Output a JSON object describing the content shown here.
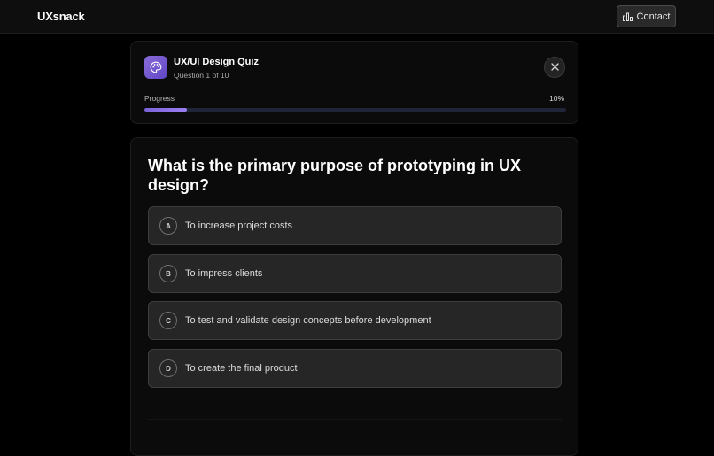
{
  "nav": {
    "logo": "UXsnack",
    "contact_label": "Contact"
  },
  "quiz": {
    "title": "UX/UI Design Quiz",
    "question_counter": "Question 1 of 10",
    "progress_label": "Progress",
    "progress_text": "10%",
    "progress_fraction": 0.1,
    "accent_color": "#7b62d8"
  },
  "question": {
    "text": "What is the primary purpose of prototyping in UX design?",
    "options": [
      {
        "letter": "A",
        "text": "To increase project costs"
      },
      {
        "letter": "B",
        "text": "To impress clients"
      },
      {
        "letter": "C",
        "text": "To test and validate design concepts before development"
      },
      {
        "letter": "D",
        "text": "To create the final product"
      }
    ]
  },
  "icons": {
    "contact": "bar-chart-icon",
    "quiz": "palette-icon",
    "close": "close-icon"
  }
}
